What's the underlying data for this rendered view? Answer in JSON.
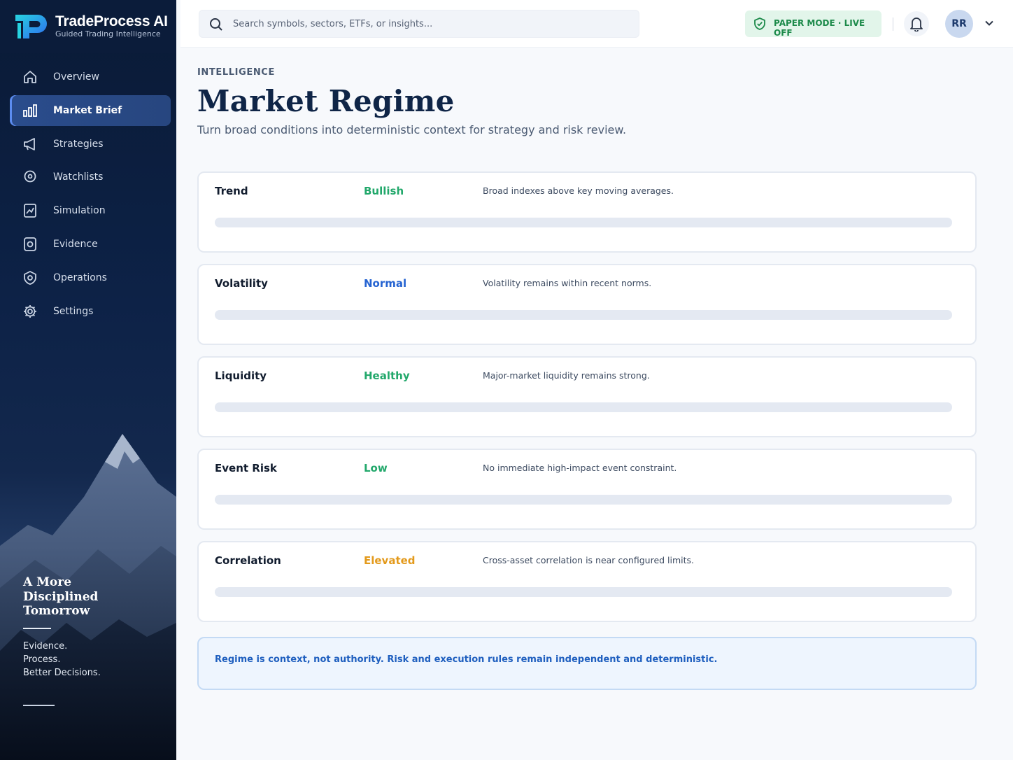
{
  "brand": {
    "name": "TradeProcess AI",
    "tagline": "Guided Trading Intelligence",
    "logo_icon": "tp-logo-icon"
  },
  "nav": [
    {
      "label": "Overview",
      "icon": "home-icon",
      "active": false
    },
    {
      "label": "Market Brief",
      "icon": "bar-chart-icon",
      "active": true
    },
    {
      "label": "Strategies",
      "icon": "megaphone-icon",
      "active": false
    },
    {
      "label": "Watchlists",
      "icon": "location-pin-icon",
      "active": false
    },
    {
      "label": "Simulation",
      "icon": "chart-square-icon",
      "active": false
    },
    {
      "label": "Evidence",
      "icon": "camera-square-icon",
      "active": false
    },
    {
      "label": "Operations",
      "icon": "shield-gear-icon",
      "active": false
    },
    {
      "label": "Settings",
      "icon": "gear-icon",
      "active": false
    }
  ],
  "sidebar_footer": {
    "slogan_lines": [
      "A More",
      "Disciplined",
      "Tomorrow"
    ],
    "sub_lines": [
      "Evidence.",
      "Process.",
      "Better Decisions."
    ]
  },
  "topbar": {
    "search_placeholder": "Search symbols, sectors, ETFs, or insights...",
    "search_value": "",
    "mode_badge": "PAPER MODE · LIVE OFF",
    "avatar_initials": "RR"
  },
  "page": {
    "eyebrow": "INTELLIGENCE",
    "title": "Market Regime",
    "subtitle": "Turn broad conditions into deterministic context for strategy and risk review."
  },
  "regimes": [
    {
      "label": "Trend",
      "status": "Bullish",
      "status_color": "#22a86b",
      "description": "Broad indexes above key moving averages.",
      "level": 0
    },
    {
      "label": "Volatility",
      "status": "Normal",
      "status_color": "#2563d1",
      "description": "Volatility remains within recent norms.",
      "level": 0
    },
    {
      "label": "Liquidity",
      "status": "Healthy",
      "status_color": "#22a86b",
      "description": "Major-market liquidity remains strong.",
      "level": 0
    },
    {
      "label": "Event Risk",
      "status": "Low",
      "status_color": "#22a86b",
      "description": "No immediate high-impact event constraint.",
      "level": 0
    },
    {
      "label": "Correlation",
      "status": "Elevated",
      "status_color": "#e39a1c",
      "description": "Cross-asset correlation is near configured limits.",
      "level": 0
    }
  ],
  "note": "Regime is context, not authority. Risk and execution rules remain independent and deterministic.",
  "colors": {
    "accent": "#2563d1",
    "success": "#22a86b",
    "warning": "#e39a1c",
    "navy": "#0f2547"
  }
}
